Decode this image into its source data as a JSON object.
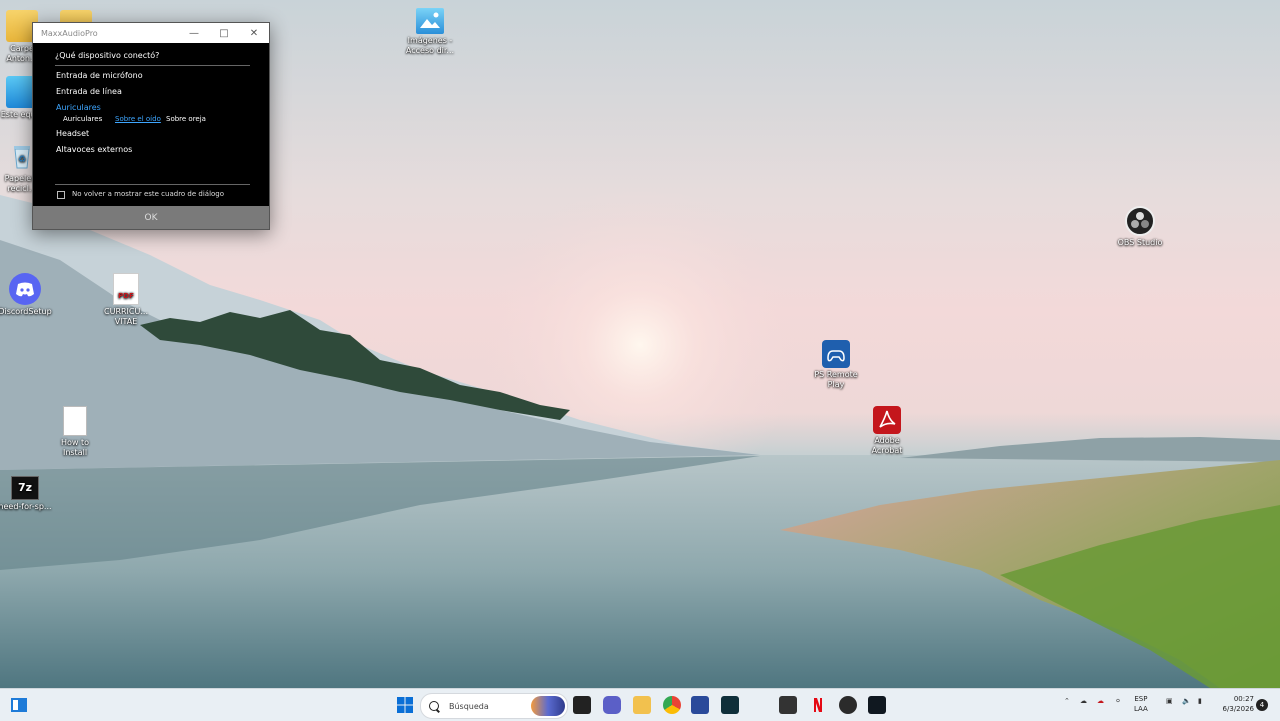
{
  "desktop": {
    "icons": [
      {
        "label": "Carpe\nAnton..."
      },
      {
        "label": ""
      },
      {
        "label": "Este equ..."
      },
      {
        "label": "Papelera\nrecicl..."
      },
      {
        "label": "DiscordSetup"
      },
      {
        "label": "CURRICU...\nVITAE"
      },
      {
        "label": "How to\nInstall"
      },
      {
        "label": "need-for-sp..."
      },
      {
        "label": "Imágenes -\nAcceso dir..."
      },
      {
        "label": "OBS Studio"
      },
      {
        "label": "PS Remote\nPlay"
      },
      {
        "label": "Adobe\nAcrobat"
      }
    ],
    "pdf_badge": "PDF",
    "sevenz_badge": "7z"
  },
  "dialog": {
    "title": "MaxxAudioPro",
    "question": "¿Qué dispositivo conectó?",
    "options": [
      "Entrada de micrófono",
      "Entrada de línea",
      "Auriculares",
      "Headset",
      "Altavoces externos"
    ],
    "selected_option": "Auriculares",
    "suboptions": [
      "Auriculares",
      "Sobre el oído",
      "Sobre oreja"
    ],
    "active_suboption": "Sobre el oído",
    "checkbox_label": "No volver a mostrar este cuadro de diálogo",
    "ok_label": "OK",
    "accent_color": "#3ea6ff"
  },
  "taskbar": {
    "search_placeholder": "Búsqueda",
    "language": {
      "line1": "ESP",
      "line2": "LAA"
    },
    "clock": {
      "time": "00:27",
      "date": "6/3/2026"
    },
    "notification_count": "4"
  }
}
